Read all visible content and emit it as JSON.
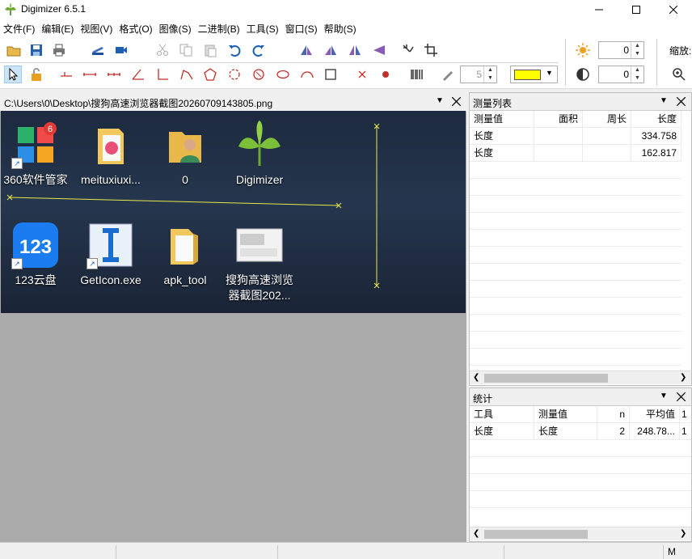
{
  "window": {
    "title": "Digimizer 6.5.1"
  },
  "menu": [
    "文件(F)",
    "编辑(E)",
    "视图(V)",
    "格式(O)",
    "图像(S)",
    "二进制(B)",
    "工具(S)",
    "窗口(S)",
    "帮助(S)"
  ],
  "toolbar": {
    "brightness_value": "0",
    "contrast_value": "0",
    "line_width_value": "5",
    "zoom_label": "缩放:",
    "color_swatch": "#ffff00"
  },
  "image_window": {
    "path": "C:\\Users\\0\\Desktop\\搜狗高速浏览器截图20260709143805.png",
    "icons": [
      {
        "label": "360软件管家",
        "icon": "360-app-icon"
      },
      {
        "label": "meituxiuxi...",
        "icon": "folder-icon"
      },
      {
        "label": "0",
        "icon": "user-folder-icon"
      },
      {
        "label": "Digimizer",
        "icon": "digimizer-icon"
      },
      {
        "label": "123云盘",
        "icon": "cloud-disk-icon"
      },
      {
        "label": "GetIcon.exe",
        "icon": "exe-icon"
      },
      {
        "label": "apk_tool",
        "icon": "folder-icon"
      },
      {
        "label": "搜狗高速浏览器截图202...",
        "icon": "screenshot-icon"
      }
    ]
  },
  "measurement_list": {
    "title": "测量列表",
    "columns": [
      "测量值",
      "面积",
      "周长",
      "长度"
    ],
    "rows": [
      [
        "长度",
        "",
        "",
        "334.758"
      ],
      [
        "长度",
        "",
        "",
        "162.817"
      ]
    ]
  },
  "statistics": {
    "title": "统计",
    "columns": [
      "工具",
      "测量值",
      "n",
      "平均值",
      "1"
    ],
    "rows": [
      [
        "长度",
        "长度",
        "2",
        "248.78...",
        "1"
      ]
    ]
  },
  "statusbar": {
    "mode": "M"
  },
  "colors": {
    "overlay_line": "#e8e84a",
    "accent": "#0078d7"
  }
}
